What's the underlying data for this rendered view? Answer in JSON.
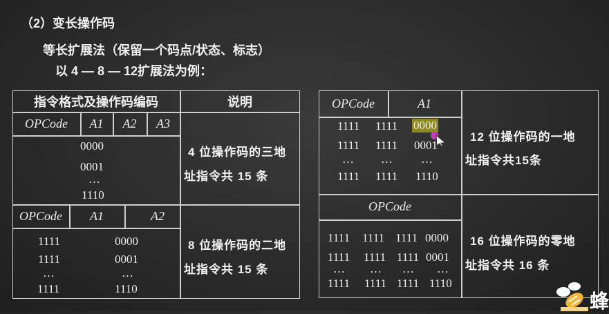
{
  "slide": {
    "section_title": "（2）变长操作码",
    "subtitle": "等长扩展法（保留一个码点/状态、标志）",
    "example_line": "以 4 — 8 — 12扩展法为例："
  },
  "left_table": {
    "header_format": "指令格式及操作码编码",
    "header_desc": "说明",
    "block1": {
      "fields": [
        "OPCode",
        "A1",
        "A2",
        "A3"
      ],
      "codes": [
        "0000",
        "0001",
        "…",
        "1110"
      ],
      "desc_line1": "4 位操作码的三地",
      "desc_line2": "址指令共 15 条"
    },
    "block2": {
      "fields": [
        "OPCode",
        "A1",
        "A2"
      ],
      "col1": [
        "1111",
        "1111",
        "…",
        "1111"
      ],
      "col2": [
        "0000",
        "0001",
        "…",
        "1110"
      ],
      "desc_line1": "8 位操作码的二地",
      "desc_line2": "址指令共 15 条"
    }
  },
  "right_table": {
    "block1": {
      "fields": [
        "OPCode",
        "A1"
      ],
      "col1": [
        "1111",
        "1111",
        "…",
        "1111"
      ],
      "col2": [
        "1111",
        "1111",
        "…",
        "1111"
      ],
      "col3": [
        "0000",
        "0001",
        "…",
        "1110"
      ],
      "desc_line1": "12 位操作码的一地",
      "desc_line2": "址指令共15条"
    },
    "block2": {
      "fields": [
        "OPCode"
      ],
      "col1": [
        "1111",
        "1111",
        "…",
        "1111"
      ],
      "col2": [
        "1111",
        "1111",
        "…",
        "1111"
      ],
      "col3": [
        "1111",
        "1111",
        "…",
        "1111"
      ],
      "col4": [
        "0000",
        "0001",
        "…",
        "1110"
      ],
      "desc_line1": "16 位操作码的零地",
      "desc_line2": "址指令共 16 条"
    }
  },
  "logo": {
    "text": "蜂"
  },
  "colors": {
    "highlight": "#8c8a1e",
    "cursor_dot": "#c23bbd",
    "chalk": "#cfcfcf"
  }
}
